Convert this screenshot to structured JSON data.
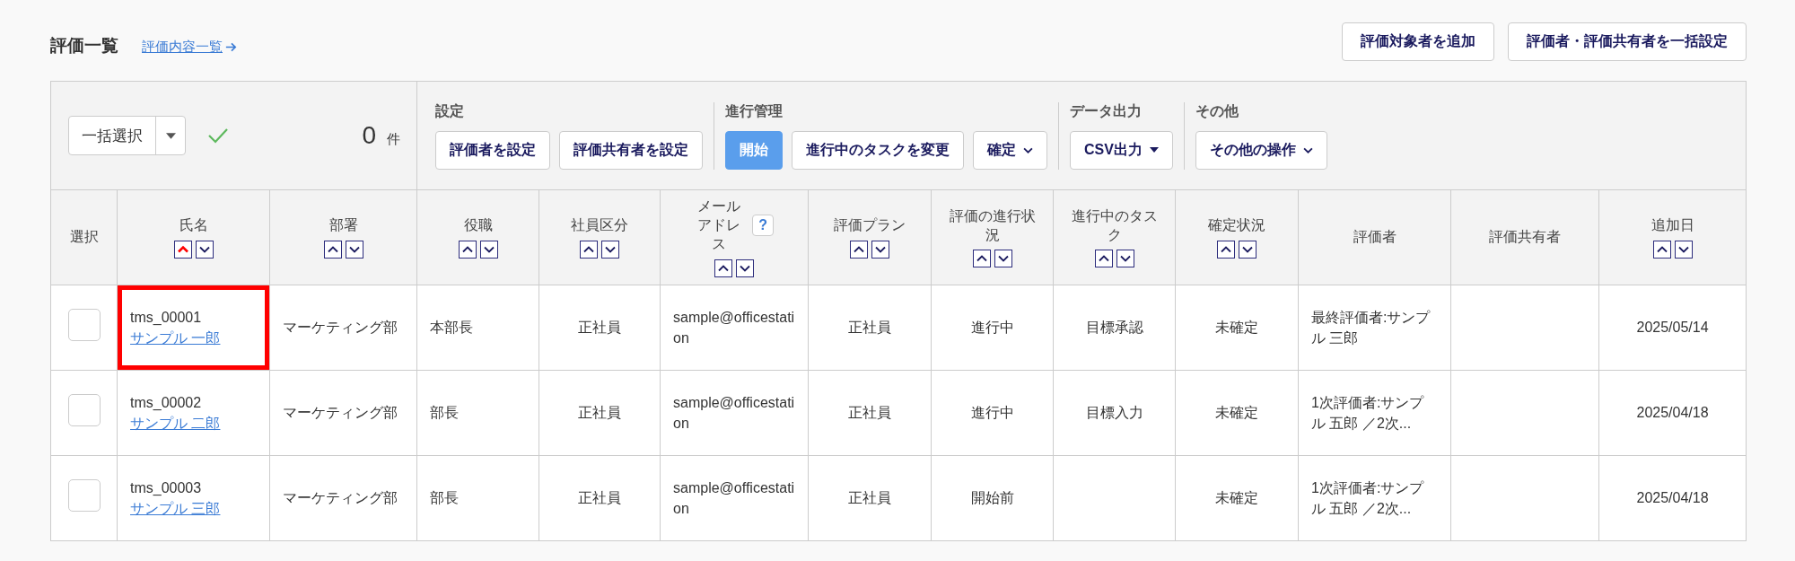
{
  "page": {
    "title": "評価一覧",
    "link": "評価内容一覧"
  },
  "top_buttons": [
    "評価対象者を追加",
    "評価者・評価共有者を一括設定"
  ],
  "toolbar": {
    "bulk_select": "一括選択",
    "count": "0",
    "count_unit": "件",
    "groups": [
      {
        "label": "設定",
        "buttons": [
          {
            "label": "評価者を設定",
            "kind": "plain"
          },
          {
            "label": "評価共有者を設定",
            "kind": "plain"
          }
        ]
      },
      {
        "label": "進行管理",
        "buttons": [
          {
            "label": "開始",
            "kind": "primary"
          },
          {
            "label": "進行中のタスクを変更",
            "kind": "plain"
          },
          {
            "label": "確定",
            "kind": "menu"
          }
        ]
      },
      {
        "label": "データ出力",
        "buttons": [
          {
            "label": "CSV出力",
            "kind": "dropdown"
          }
        ]
      },
      {
        "label": "その他",
        "buttons": [
          {
            "label": "その他の操作",
            "kind": "menu"
          }
        ]
      }
    ]
  },
  "table": {
    "columns": [
      {
        "label": "選択",
        "sortable": false
      },
      {
        "label": "氏名",
        "sortable": true,
        "sort_ascending": true
      },
      {
        "label": "部署",
        "sortable": true,
        "sort_ascending": false
      },
      {
        "label": "役職",
        "sortable": true,
        "sort_ascending": false
      },
      {
        "label": "社員区分",
        "sortable": true,
        "sort_ascending": false
      },
      {
        "label": "メールアドレス",
        "sortable": true,
        "sort_ascending": false,
        "help": "?"
      },
      {
        "label": "評価プラン",
        "sortable": true,
        "sort_ascending": false
      },
      {
        "label": "評価の進行状況",
        "sortable": true,
        "sort_ascending": false
      },
      {
        "label": "進行中のタスク",
        "sortable": true,
        "sort_ascending": false
      },
      {
        "label": "確定状況",
        "sortable": true,
        "sort_ascending": false
      },
      {
        "label": "評価者",
        "sortable": false
      },
      {
        "label": "評価共有者",
        "sortable": false
      },
      {
        "label": "追加日",
        "sortable": true,
        "sort_ascending": false
      }
    ],
    "rows": [
      {
        "checked": false,
        "highlighted": true,
        "id": "tms_00001",
        "name": "サンプル 一郎",
        "department": "マーケティング部",
        "position": "本部長",
        "employment_type": "正社員",
        "email": "sample@officestation",
        "plan": "正社員",
        "progress": "進行中",
        "task": "目標承認",
        "status": "未確定",
        "evaluators": "最終評価者:サンプル 三郎",
        "added": "2025/05/14"
      },
      {
        "checked": false,
        "highlighted": false,
        "id": "tms_00002",
        "name": "サンプル 二郎",
        "department": "マーケティング部",
        "position": "部長",
        "employment_type": "正社員",
        "email": "sample@officestation",
        "plan": "正社員",
        "progress": "進行中",
        "task": "目標入力",
        "status": "未確定",
        "evaluators": "1次評価者:サンプル 五郎 ／2次...",
        "added": "2025/04/18"
      },
      {
        "checked": false,
        "highlighted": false,
        "id": "tms_00003",
        "name": "サンプル 三郎",
        "department": "マーケティング部",
        "position": "部長",
        "employment_type": "正社員",
        "email": "sample@officestation",
        "plan": "正社員",
        "progress": "開始前",
        "status": "未確定",
        "evaluators": "1次評価者:サンプル 五郎 ／2次...",
        "added": "2025/04/18"
      }
    ]
  }
}
